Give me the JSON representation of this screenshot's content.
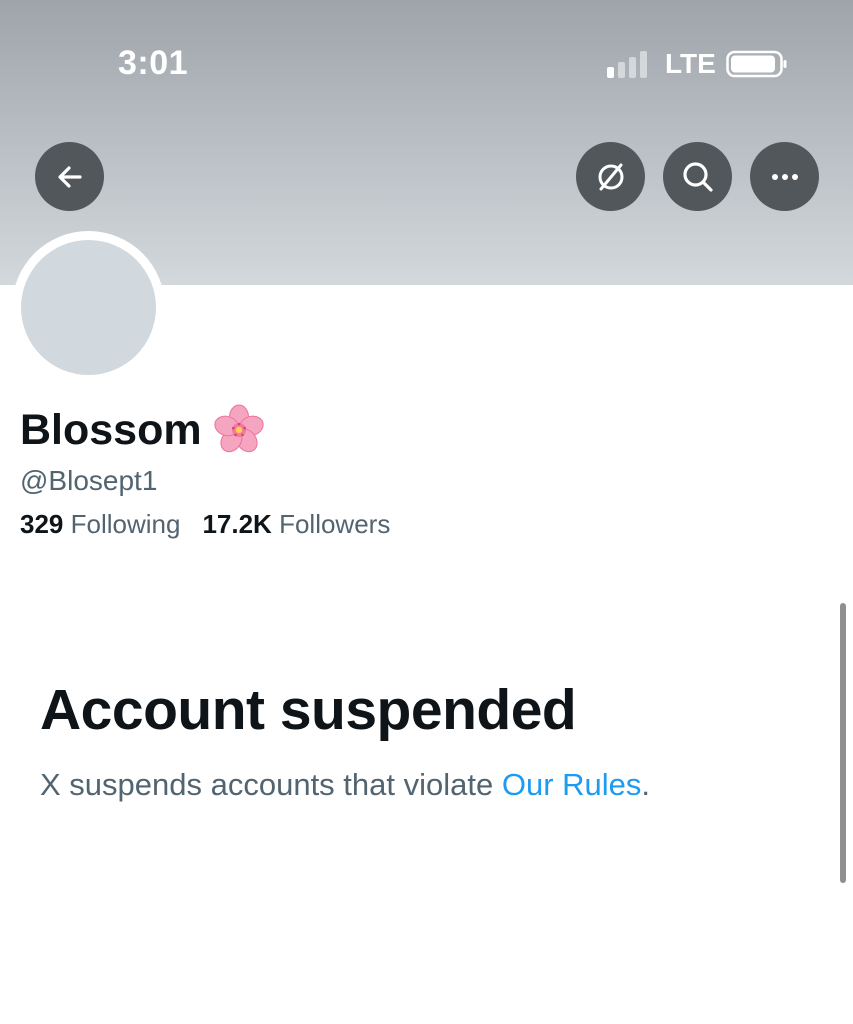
{
  "status_bar": {
    "time": "3:01",
    "network": "LTE",
    "signal_bars_active": 1,
    "signal_bars_total": 4
  },
  "nav": {
    "back_icon": "arrow-left-icon",
    "grok_icon": "grok-icon",
    "search_icon": "search-icon",
    "more_icon": "more-horizontal-icon"
  },
  "profile": {
    "display_name": "Blossom",
    "name_emoji": "cherry-blossom-emoji",
    "handle": "@Blosept1",
    "following_count": "329",
    "following_label": "Following",
    "followers_count": "17.2K",
    "followers_label": "Followers"
  },
  "suspension": {
    "title": "Account suspended",
    "description_prefix": "X suspends accounts that violate ",
    "rules_link": "Our Rules",
    "description_suffix": "."
  },
  "colors": {
    "primary_text": "#0f1419",
    "secondary_text": "#536471",
    "link": "#1d9bf0",
    "nav_button_bg": "#52575b",
    "avatar_placeholder": "#d1d9de"
  }
}
